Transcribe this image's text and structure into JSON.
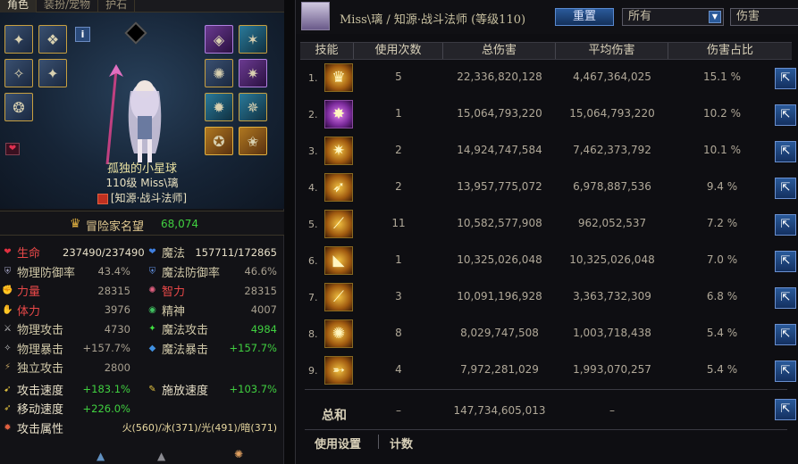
{
  "left": {
    "tabs": [
      "角色",
      "装扮/宠物",
      "护石"
    ],
    "character_name": "孤独的小星球",
    "level_line": "110级 Miss\\璃",
    "class_name": "[知源·战斗法师]",
    "reputation_label": "冒险家名望",
    "reputation_value": "68,074",
    "stats": [
      {
        "l": "生命",
        "lv": "237490/237490",
        "r": "魔法",
        "rv": "157711/172865"
      },
      {
        "l": "物理防御率",
        "lv": "43.4%",
        "r": "魔法防御率",
        "rv": "46.6%"
      },
      {
        "l": "力量",
        "lv": "28315",
        "r": "智力",
        "rv": "28315"
      },
      {
        "l": "体力",
        "lv": "3976",
        "r": "精神",
        "rv": "4007"
      },
      {
        "l": "物理攻击",
        "lv": "4730",
        "r": "魔法攻击",
        "rv": "4984"
      },
      {
        "l": "物理暴击",
        "lv": "+157.7%",
        "r": "魔法暴击",
        "rv": "+157.7%"
      },
      {
        "l": "独立攻击",
        "lv": "2800",
        "r": "",
        "rv": ""
      },
      {
        "l": "攻击速度",
        "lv": "+183.1%",
        "r": "施放速度",
        "rv": "+103.7%"
      },
      {
        "l": "移动速度",
        "lv": "+226.0%",
        "r": "",
        "rv": ""
      },
      {
        "l": "攻击属性",
        "lv": "火(560)/冰(371)/光(491)/暗(371)",
        "r": "",
        "rv": ""
      }
    ]
  },
  "right": {
    "title": "Miss\\璃 / 知源·战斗法师 (等级110)",
    "reset_label": "重置",
    "filter_value": "所有",
    "sort_value": "伤害",
    "headers": [
      "技能",
      "使用次数",
      "总伤害",
      "平均伤害",
      "伤害占比"
    ],
    "rows": [
      {
        "n": "1.",
        "uses": "5",
        "total": "22,336,820,128",
        "avg": "4,467,364,025",
        "pct": "15.1 %"
      },
      {
        "n": "2.",
        "uses": "1",
        "total": "15,064,793,220",
        "avg": "15,064,793,220",
        "pct": "10.2 %"
      },
      {
        "n": "3.",
        "uses": "2",
        "total": "14,924,747,584",
        "avg": "7,462,373,792",
        "pct": "10.1 %"
      },
      {
        "n": "4.",
        "uses": "2",
        "total": "13,957,775,072",
        "avg": "6,978,887,536",
        "pct": "9.4 %"
      },
      {
        "n": "5.",
        "uses": "11",
        "total": "10,582,577,908",
        "avg": "962,052,537",
        "pct": "7.2 %"
      },
      {
        "n": "6.",
        "uses": "1",
        "total": "10,325,026,048",
        "avg": "10,325,026,048",
        "pct": "7.0 %"
      },
      {
        "n": "7.",
        "uses": "3",
        "total": "10,091,196,928",
        "avg": "3,363,732,309",
        "pct": "6.8 %"
      },
      {
        "n": "8.",
        "uses": "8",
        "total": "8,029,747,508",
        "avg": "1,003,718,438",
        "pct": "5.4 %"
      },
      {
        "n": "9.",
        "uses": "4",
        "total": "7,972,281,029",
        "avg": "1,993,070,257",
        "pct": "5.4 %"
      }
    ],
    "total_label": "总和",
    "total_uses": "–",
    "total_damage": "147,734,605,013",
    "total_avg": "–",
    "footer_settings": "使用设置",
    "footer_count": "计数"
  }
}
